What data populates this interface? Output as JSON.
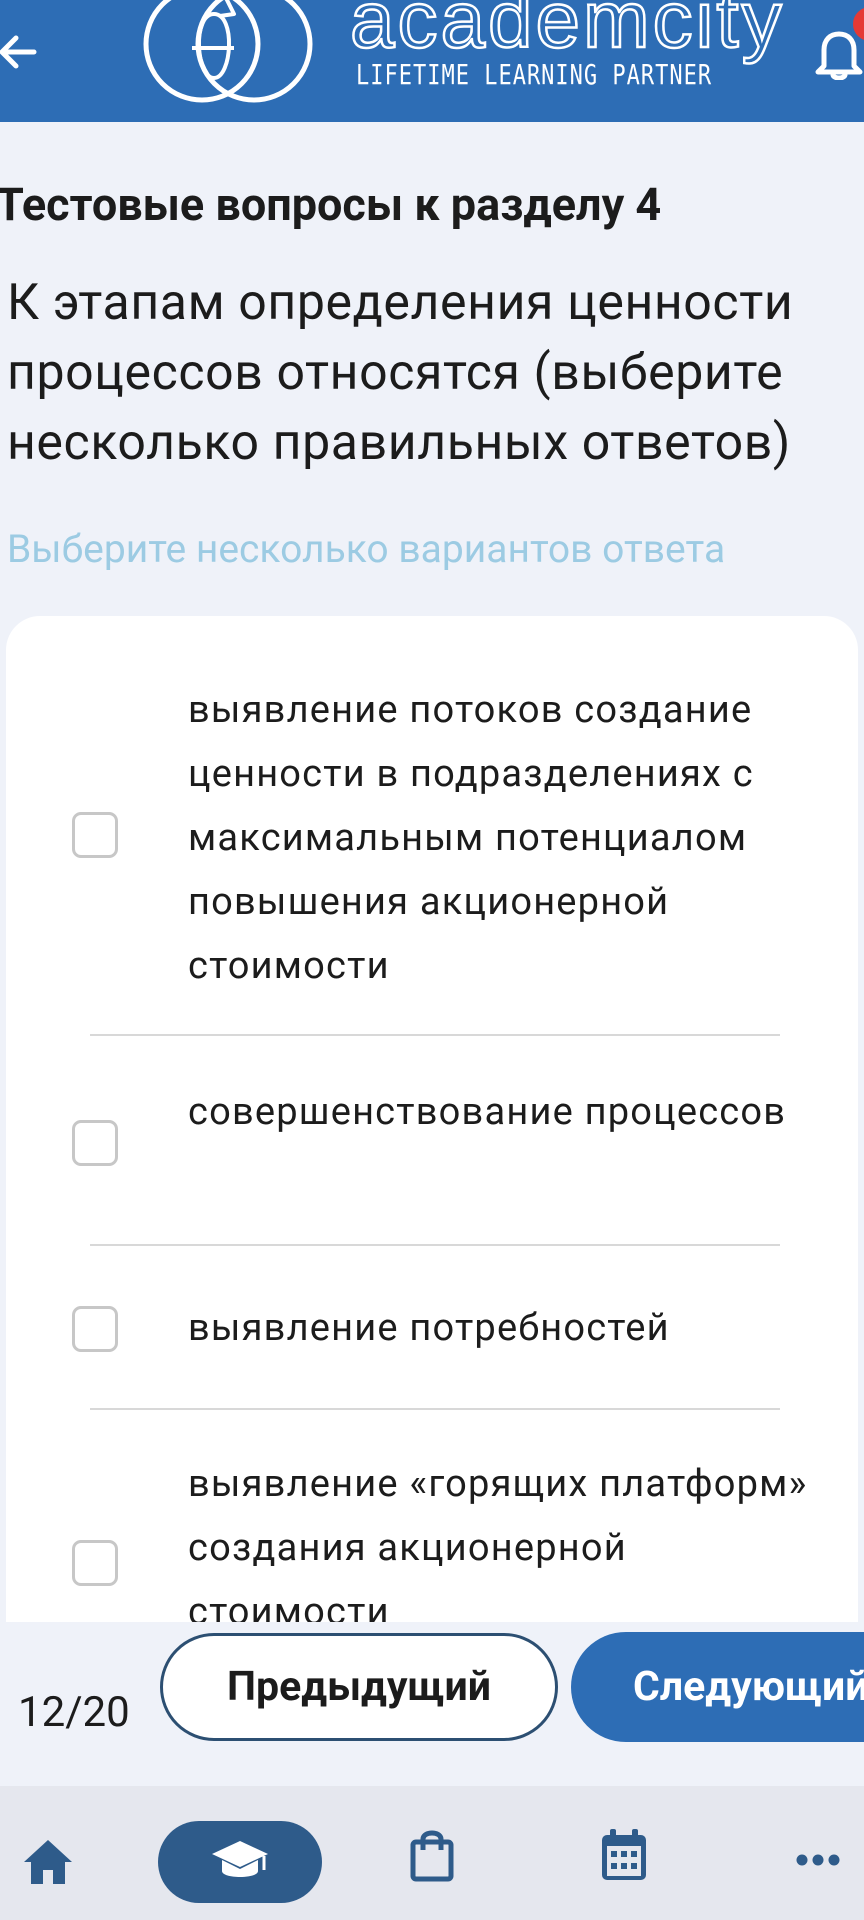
{
  "header": {
    "brand_name": "academcity",
    "tagline": "LIFETIME LEARNING PARTNER",
    "back_icon": "arrow-left-icon",
    "notification_icon": "bell-icon",
    "colors": {
      "background": "#2d6db5",
      "foreground": "#ffffff",
      "badge": "#e53935"
    }
  },
  "section_title": "Тестовые вопросы к разделу 4",
  "question": {
    "text": "К этапам определения ценности процессов относятся (выберите несколько правильных ответов)",
    "hint": "Выберите несколько вариантов ответа"
  },
  "options": [
    {
      "label": "выявление потоков создание ценности в подразделениях с максимальным потенциалом повышения акционерной стоимости",
      "checked": false
    },
    {
      "label": "совершенствование процессов",
      "checked": false
    },
    {
      "label": "выявление потребностей",
      "checked": false
    },
    {
      "label": "выявление «горящих платформ» создания акционерной стоимости",
      "checked": false
    }
  ],
  "pager": {
    "counter": "12/20",
    "prev_label": "Предыдущий",
    "next_label": "Следующий"
  },
  "bottom_nav": {
    "items": [
      {
        "icon": "home-icon",
        "active": false
      },
      {
        "icon": "graduation-cap-icon",
        "active": true
      },
      {
        "icon": "shopping-bag-icon",
        "active": false
      },
      {
        "icon": "calendar-icon",
        "active": false
      },
      {
        "icon": "more-dots-icon",
        "active": false
      }
    ],
    "colors": {
      "icon": "#2e5b8a",
      "active_pill": "#2e5b8a",
      "background": "#e5e7ee"
    }
  },
  "colors": {
    "accent": "#2d6db5",
    "hint": "#9ccbe3",
    "page_background": "#eff2f9"
  }
}
